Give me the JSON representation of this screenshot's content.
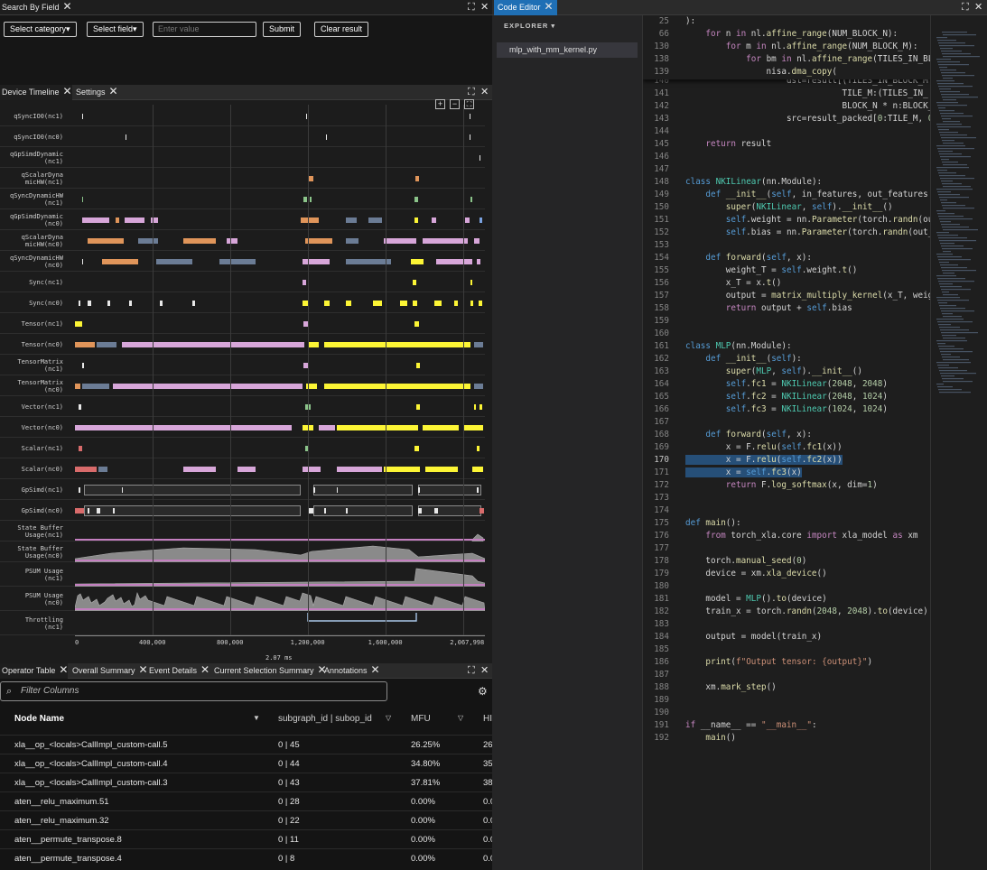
{
  "search_panel": {
    "tab": "Search By Field",
    "category_btn": "Select category▾",
    "field_btn": "Select field▾",
    "value_placeholder": "Enter value",
    "submit": "Submit",
    "clear": "Clear result"
  },
  "timeline_panel": {
    "tabs": [
      "Device Timeline",
      "Settings"
    ],
    "zoom_in": "+",
    "zoom_out": "−",
    "fit": "⛶",
    "rows": [
      "qSyncIO0(nc1)",
      "qSyncIO0(nc0)",
      "qGpSimdDynamic\n(nc1)",
      "qScalarDyna\nmicHW(nc1)",
      "qSyncDynamicHW\n(nc1)",
      "qGpSimdDynamic\n(nc0)",
      "qScalarDyna\nmicHW(nc0)",
      "qSyncDynamicHW\n(nc0)",
      "Sync(nc1)",
      "Sync(nc0)",
      "Tensor(nc1)",
      "Tensor(nc0)",
      "TensorMatrix\n(nc1)",
      "TensorMatrix\n(nc0)",
      "Vector(nc1)",
      "Vector(nc0)",
      "Scalar(nc1)",
      "Scalar(nc0)",
      "GpSimd(nc1)",
      "GpSimd(nc0)",
      "State Buffer\nUsage(nc1)",
      "State Buffer\nUsage(nc0)",
      "PSUM Usage\n(nc1)",
      "PSUM Usage\n(nc0)",
      "Throttling\n(nc1)"
    ],
    "x_ticks": [
      "0",
      "400,000",
      "800,000",
      "1,200,000",
      "1,600,000",
      "2,067,998"
    ],
    "duration": "2.07 ms",
    "colors": {
      "yellow": "#fcf535",
      "pink": "#d7a6d9",
      "orange": "#e0955a",
      "slate": "#6b7c95",
      "green": "#8bc48a",
      "red": "#d86b6b",
      "white": "#e8e8e8",
      "blue": "#7aa2e0"
    }
  },
  "table_panel": {
    "tabs": [
      "Operator Table",
      "Overall Summary",
      "Event Details",
      "Current Selection Summary",
      "Annotations"
    ],
    "filter_placeholder": "Filter Columns",
    "columns": [
      "Node Name",
      "subgraph_id | subop_id",
      "MFU",
      "HI"
    ],
    "rows": [
      {
        "name": "xla__op_<locals>CallImpl_custom-call.5",
        "ids": "0 | 45",
        "mfu": "26.25%",
        "hi": "26"
      },
      {
        "name": "xla__op_<locals>CallImpl_custom-call.4",
        "ids": "0 | 44",
        "mfu": "34.80%",
        "hi": "35"
      },
      {
        "name": "xla__op_<locals>CallImpl_custom-call.3",
        "ids": "0 | 43",
        "mfu": "37.81%",
        "hi": "38"
      },
      {
        "name": "aten__relu_maximum.51",
        "ids": "0 | 28",
        "mfu": "0.00%",
        "hi": "0.0"
      },
      {
        "name": "aten__relu_maximum.32",
        "ids": "0 | 22",
        "mfu": "0.00%",
        "hi": "0.0"
      },
      {
        "name": "aten__permute_transpose.8",
        "ids": "0 | 11",
        "mfu": "0.00%",
        "hi": "0.0"
      },
      {
        "name": "aten__permute_transpose.4",
        "ids": "0 | 8",
        "mfu": "0.00%",
        "hi": "0.0"
      }
    ]
  },
  "editor_panel": {
    "tab": "Code Editor",
    "explorer_title": "EXPLORER ▾",
    "file": "mlp_with_mm_kernel.py",
    "sticky": [
      {
        "n": "25",
        "t": "):"
      },
      {
        "n": "66",
        "t": "    for n in nl.affine_range(NUM_BLOCK_N):"
      },
      {
        "n": "130",
        "t": "        for m in nl.affine_range(NUM_BLOCK_M):"
      },
      {
        "n": "138",
        "t": "            for bm in nl.affine_range(TILES_IN_BL"
      },
      {
        "n": "139",
        "t": "                nisa.dma_copy("
      }
    ],
    "lines": [
      {
        "n": "140",
        "t": "                    dst=result[(TILES_IN_BLOCK_M"
      },
      {
        "n": "141",
        "t": "                               TILE_M:(TILES_IN_"
      },
      {
        "n": "142",
        "t": "                               BLOCK_N * n:BLOCK_"
      },
      {
        "n": "143",
        "t": "                    src=result_packed[0:TILE_M, 0"
      },
      {
        "n": "144",
        "t": ""
      },
      {
        "n": "145",
        "t": "    return result"
      },
      {
        "n": "146",
        "t": ""
      },
      {
        "n": "147",
        "t": ""
      },
      {
        "n": "148",
        "t": "class NKILinear(nn.Module):"
      },
      {
        "n": "149",
        "t": "    def __init__(self, in_features, out_features"
      },
      {
        "n": "150",
        "t": "        super(NKILinear, self).__init__()"
      },
      {
        "n": "151",
        "t": "        self.weight = nn.Parameter(torch.randn(ou"
      },
      {
        "n": "152",
        "t": "        self.bias = nn.Parameter(torch.randn(out_"
      },
      {
        "n": "153",
        "t": ""
      },
      {
        "n": "154",
        "t": "    def forward(self, x):"
      },
      {
        "n": "155",
        "t": "        weight_T = self.weight.t()"
      },
      {
        "n": "156",
        "t": "        x_T = x.t()"
      },
      {
        "n": "157",
        "t": "        output = matrix_multiply_kernel(x_T, weig"
      },
      {
        "n": "158",
        "t": "        return output + self.bias"
      },
      {
        "n": "159",
        "t": ""
      },
      {
        "n": "160",
        "t": ""
      },
      {
        "n": "161",
        "t": "class MLP(nn.Module):"
      },
      {
        "n": "162",
        "t": "    def __init__(self):"
      },
      {
        "n": "163",
        "t": "        super(MLP, self).__init__()"
      },
      {
        "n": "164",
        "t": "        self.fc1 = NKILinear(2048, 2048)"
      },
      {
        "n": "165",
        "t": "        self.fc2 = NKILinear(2048, 1024)"
      },
      {
        "n": "166",
        "t": "        self.fc3 = NKILinear(1024, 1024)"
      },
      {
        "n": "167",
        "t": ""
      },
      {
        "n": "168",
        "t": "    def forward(self, x):"
      },
      {
        "n": "169",
        "t": "        x = F.relu(self.fc1(x))"
      },
      {
        "n": "170",
        "t": "        x = F.relu(self.fc2(x))"
      },
      {
        "n": "171",
        "t": "        x = self.fc3(x)"
      },
      {
        "n": "172",
        "t": "        return F.log_softmax(x, dim=1)"
      },
      {
        "n": "173",
        "t": ""
      },
      {
        "n": "174",
        "t": ""
      },
      {
        "n": "175",
        "t": "def main():"
      },
      {
        "n": "176",
        "t": "    from torch_xla.core import xla_model as xm"
      },
      {
        "n": "177",
        "t": ""
      },
      {
        "n": "178",
        "t": "    torch.manual_seed(0)"
      },
      {
        "n": "179",
        "t": "    device = xm.xla_device()"
      },
      {
        "n": "180",
        "t": ""
      },
      {
        "n": "181",
        "t": "    model = MLP().to(device)"
      },
      {
        "n": "182",
        "t": "    train_x = torch.randn(2048, 2048).to(device)"
      },
      {
        "n": "183",
        "t": ""
      },
      {
        "n": "184",
        "t": "    output = model(train_x)"
      },
      {
        "n": "185",
        "t": ""
      },
      {
        "n": "186",
        "t": "    print(f\"Output tensor: {output}\")"
      },
      {
        "n": "187",
        "t": ""
      },
      {
        "n": "188",
        "t": "    xm.mark_step()"
      },
      {
        "n": "189",
        "t": ""
      },
      {
        "n": "190",
        "t": ""
      },
      {
        "n": "191",
        "t": "if __name__ == \"__main__\":"
      },
      {
        "n": "192",
        "t": "    main()"
      }
    ],
    "selected_lines": [
      "170",
      "171"
    ],
    "current_line": "170"
  }
}
